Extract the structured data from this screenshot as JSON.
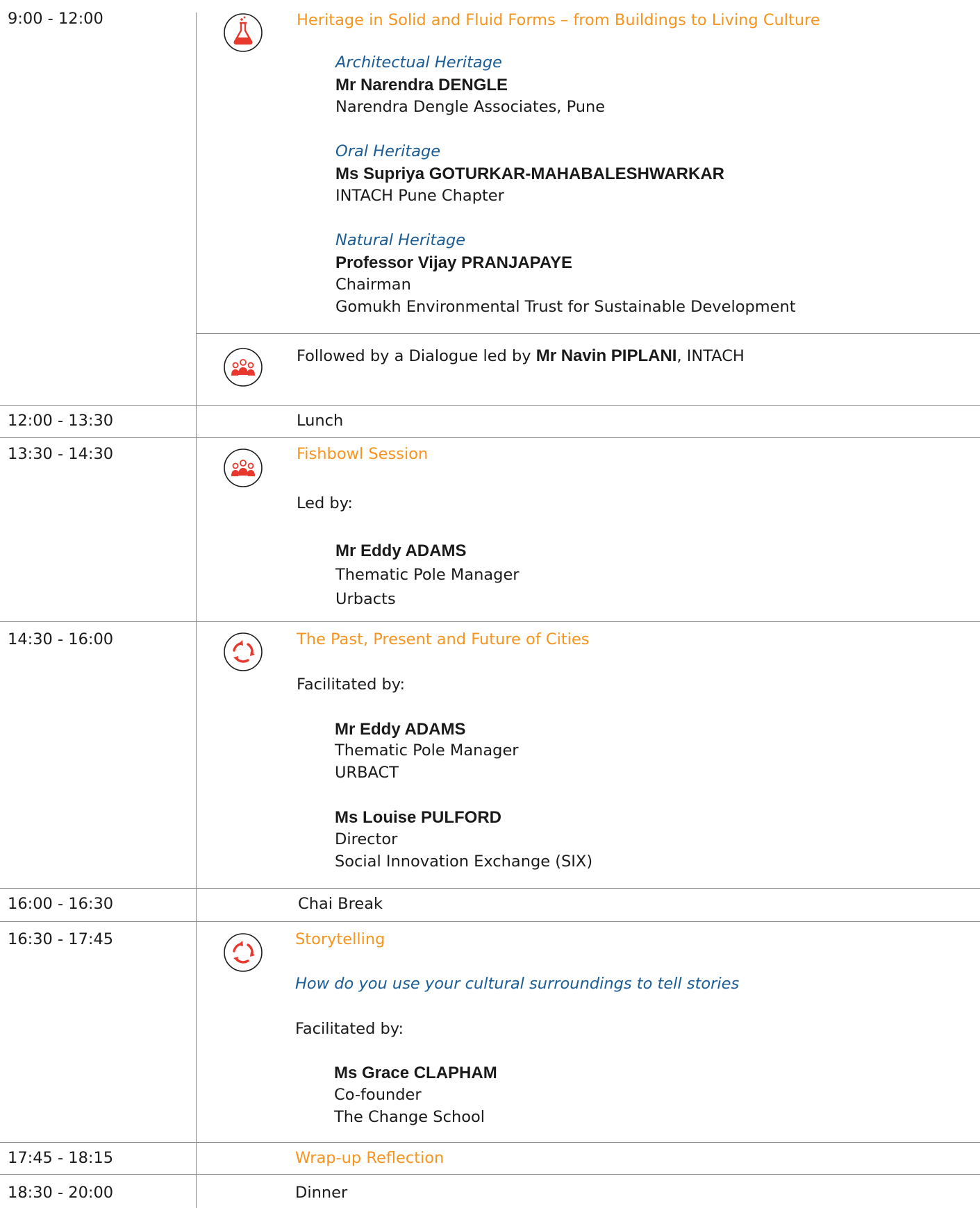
{
  "colors": {
    "accent": "#f7941d",
    "subtitle": "#1a5c96",
    "icon": "#e8372c",
    "rule": "#8a8a8a"
  },
  "s1": {
    "time": "9:00 - 12:00",
    "icon": "flask-icon",
    "title": "Heritage in Solid and Fluid Forms – from Buildings to Living Culture",
    "talks": [
      {
        "topic": "Architectual Heritage",
        "name": "Mr Narendra DENGLE",
        "lines": [
          "Narendra Dengle Associates, Pune"
        ]
      },
      {
        "topic": "Oral Heritage",
        "name": "Ms Supriya GOTURKAR-MAHABALESHWARKAR",
        "lines": [
          "INTACH Pune Chapter"
        ]
      },
      {
        "topic": "Natural Heritage",
        "name": "Professor Vijay PRANJAPAYE",
        "lines": [
          "Chairman",
          "Gomukh Environmental Trust for Sustainable Development"
        ]
      }
    ],
    "dialogue": {
      "icon": "group-icon",
      "pre": "Followed by a Dialogue led by ",
      "name": "Mr Navin PIPLANI",
      "post": ", INTACH"
    }
  },
  "s2": {
    "time": "12:00 - 13:30",
    "label": "Lunch"
  },
  "s3": {
    "time": "13:30 - 14:30",
    "icon": "group-icon",
    "title": "Fishbowl Session",
    "lead": "Led by:",
    "name": "Mr Eddy ADAMS",
    "lines": [
      "Thematic Pole Manager",
      "Urbacts"
    ]
  },
  "s4": {
    "time": "14:30 - 16:00",
    "icon": "cycle-icon",
    "title": "The Past, Present and Future of Cities",
    "lead": "Facilitated by:",
    "people": [
      {
        "name": "Mr Eddy ADAMS",
        "lines": [
          "Thematic Pole Manager",
          "URBACT"
        ]
      },
      {
        "name": "Ms Louise PULFORD",
        "lines": [
          "Director",
          "Social Innovation Exchange (SIX)"
        ]
      }
    ]
  },
  "s5": {
    "time": "16:00 - 16:30",
    "label": "Chai Break"
  },
  "s6": {
    "time": "16:30 - 17:45",
    "icon": "cycle-icon",
    "title": "Storytelling",
    "subtitle": "How do you use your cultural surroundings to tell stories",
    "lead": "Facilitated by:",
    "name": "Ms Grace CLAPHAM",
    "lines": [
      "Co-founder",
      "The Change School"
    ]
  },
  "s7": {
    "time": "17:45 - 18:15",
    "label": "Wrap-up Reflection"
  },
  "s8": {
    "time": "18:30 - 20:00",
    "label": "Dinner"
  }
}
